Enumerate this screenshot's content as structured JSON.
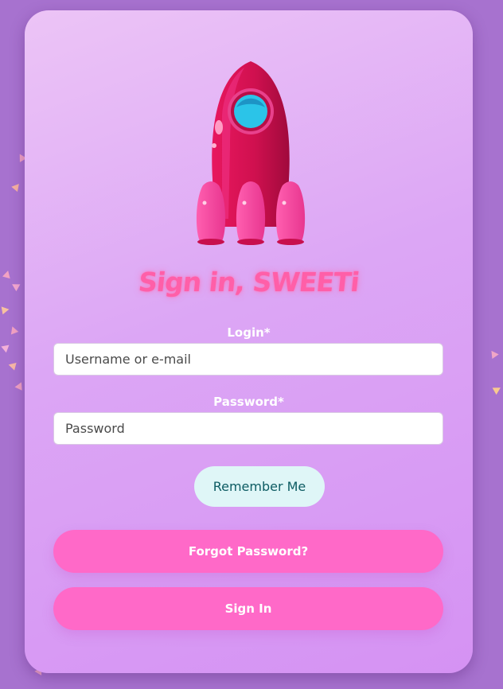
{
  "title": "Sign in, SWEETi",
  "login": {
    "label": "Login*",
    "placeholder": "Username or e-mail",
    "value": ""
  },
  "password": {
    "label": "Password*",
    "placeholder": "Password",
    "value": ""
  },
  "remember_label": "Remember Me",
  "forgot_label": "Forgot Password?",
  "signin_label": "Sign In",
  "icons": {
    "logo": "rocket-icon"
  },
  "colors": {
    "page_background": "#a772cf",
    "title": "#ff5fa8",
    "pill_button": "#ff69c8",
    "remember_button_bg": "#dff6f7",
    "remember_button_text": "#0d5c63"
  }
}
